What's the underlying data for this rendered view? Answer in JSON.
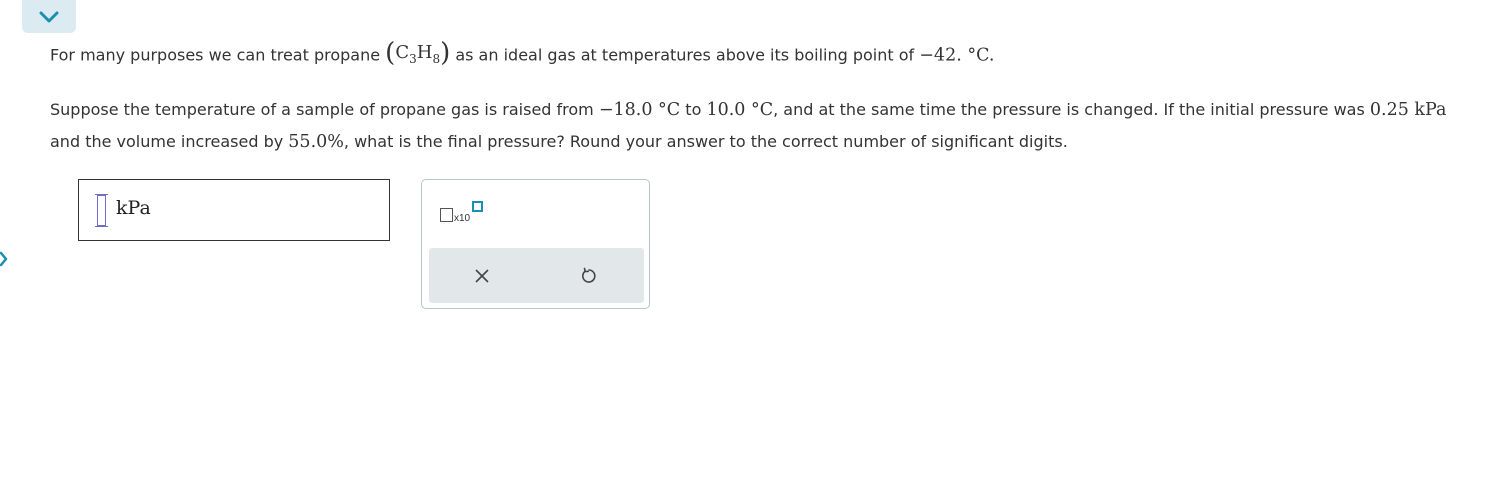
{
  "icons": {
    "collapse": "chevron-down-icon",
    "left_nav": "chevron-left-icon",
    "clear": "close-icon",
    "undo": "undo-icon"
  },
  "colors": {
    "accent": "#1a8fb0",
    "tab_bg": "#dcebf2",
    "toolbar_bg": "#e2e8ea",
    "text": "#333333"
  },
  "question": {
    "line1": {
      "text_a": "For many purposes we can treat propane",
      "formula": {
        "open": "(",
        "c": "C",
        "c_sub": "3",
        "h": "H",
        "h_sub": "8",
        "close": ")"
      },
      "text_b": "as an ideal gas at temperatures above its boiling point of",
      "boiling_point": "−42. °C",
      "end": "."
    },
    "line2": {
      "text_a": "Suppose the temperature of a sample of propane gas is raised from",
      "t_initial": "−18.0 °C",
      "text_b": "to",
      "t_final": "10.0 °C",
      "text_c": ", and at the same time the pressure is changed. If the initial pressure was",
      "p_initial": "0.25 kPa",
      "text_d": "and the volume increased by",
      "volume_increase": "55.0%",
      "text_e": ", what is the final pressure? Round your answer to the correct number of significant digits."
    }
  },
  "answer": {
    "value": "",
    "unit": "kPa"
  },
  "toolbar": {
    "sci_notation_label": "x10"
  }
}
